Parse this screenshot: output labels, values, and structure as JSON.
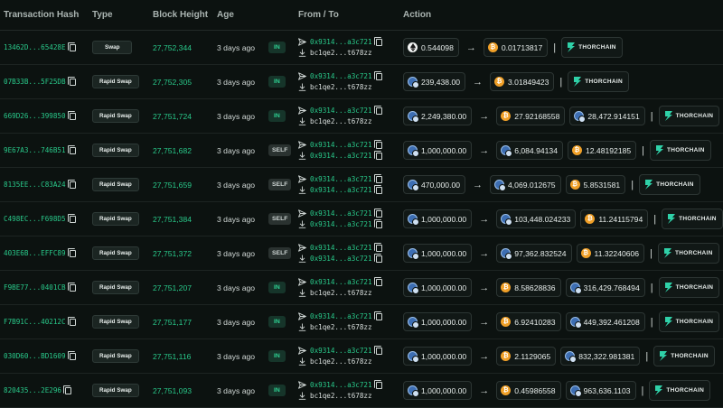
{
  "headers": {
    "hash": "Transaction Hash",
    "type": "Type",
    "block": "Block Height",
    "age": "Age",
    "from_to": "From / To",
    "action": "Action"
  },
  "colors": {
    "accent_green": "#29c98a",
    "btc_orange": "#f0a028",
    "background": "#0c1210"
  },
  "rows": [
    {
      "hash": "13462D...65428E",
      "type": "Swap",
      "block": "27,752,344",
      "age": "3 days ago",
      "dir": "IN",
      "from": "0x9314...a3c721",
      "to": "bc1qe2...t678zz",
      "action": [
        {
          "kind": "amount",
          "coin": "eth-icon",
          "text": "0.544098"
        },
        {
          "kind": "arrow",
          "text": "→"
        },
        {
          "kind": "amount",
          "coin": "btc-icon",
          "text": "0.01713817"
        },
        {
          "kind": "sep",
          "text": "|"
        },
        {
          "kind": "thorchain",
          "text": "THORCHAIN"
        }
      ]
    },
    {
      "hash": "07B33B...5F25DB",
      "type": "Rapid Swap",
      "block": "27,752,305",
      "age": "3 days ago",
      "dir": "IN",
      "from": "0x9314...a3c721",
      "to": "bc1qe2...t678zz",
      "action": [
        {
          "kind": "amount",
          "coin": "token-icon",
          "text": "239,438.00"
        },
        {
          "kind": "arrow",
          "text": "→"
        },
        {
          "kind": "amount",
          "coin": "btc-icon",
          "text": "3.01849423"
        },
        {
          "kind": "sep",
          "text": "|"
        },
        {
          "kind": "thorchain",
          "text": "THORCHAIN"
        }
      ]
    },
    {
      "hash": "669D26...399850",
      "type": "Rapid Swap",
      "block": "27,751,724",
      "age": "3 days ago",
      "dir": "IN",
      "from": "0x9314...a3c721",
      "to": "bc1qe2...t678zz",
      "action": [
        {
          "kind": "amount",
          "coin": "token-icon",
          "text": "2,249,380.00"
        },
        {
          "kind": "arrow",
          "text": "→"
        },
        {
          "kind": "amount",
          "coin": "btc-icon",
          "text": "27.92168558"
        },
        {
          "kind": "amount",
          "coin": "token-icon",
          "text": "28,472.914151"
        },
        {
          "kind": "sep",
          "text": "|"
        },
        {
          "kind": "thorchain",
          "text": "THORCHAIN"
        }
      ]
    },
    {
      "hash": "9E67A3...746B51",
      "type": "Rapid Swap",
      "block": "27,751,682",
      "age": "3 days ago",
      "dir": "SELF",
      "from": "0x9314...a3c721",
      "to": "0x9314...a3c721",
      "action": [
        {
          "kind": "amount",
          "coin": "token-icon",
          "text": "1,000,000.00"
        },
        {
          "kind": "arrow",
          "text": "→"
        },
        {
          "kind": "amount",
          "coin": "token-icon",
          "text": "6,084.94134"
        },
        {
          "kind": "amount",
          "coin": "btc-icon",
          "text": "12.48192185"
        },
        {
          "kind": "sep",
          "text": "|"
        },
        {
          "kind": "thorchain",
          "text": "THORCHAIN"
        }
      ]
    },
    {
      "hash": "8135EE...C83A24",
      "type": "Rapid Swap",
      "block": "27,751,659",
      "age": "3 days ago",
      "dir": "SELF",
      "from": "0x9314...a3c721",
      "to": "0x9314...a3c721",
      "action": [
        {
          "kind": "amount",
          "coin": "token-icon",
          "text": "470,000.00"
        },
        {
          "kind": "arrow",
          "text": "→"
        },
        {
          "kind": "amount",
          "coin": "token-icon",
          "text": "4,069.012675"
        },
        {
          "kind": "amount",
          "coin": "btc-icon",
          "text": "5.8531581"
        },
        {
          "kind": "sep",
          "text": "|"
        },
        {
          "kind": "thorchain",
          "text": "THORCHAIN"
        }
      ]
    },
    {
      "hash": "C498EC...F698D5",
      "type": "Rapid Swap",
      "block": "27,751,384",
      "age": "3 days ago",
      "dir": "SELF",
      "from": "0x9314...a3c721",
      "to": "0x9314...a3c721",
      "action": [
        {
          "kind": "amount",
          "coin": "token-icon",
          "text": "1,000,000.00"
        },
        {
          "kind": "arrow",
          "text": "→"
        },
        {
          "kind": "amount",
          "coin": "token-icon",
          "text": "103,448.024233"
        },
        {
          "kind": "amount",
          "coin": "btc-icon",
          "text": "11.24115794"
        },
        {
          "kind": "sep",
          "text": "|"
        },
        {
          "kind": "thorchain",
          "text": "THORCHAIN"
        }
      ]
    },
    {
      "hash": "403E6B...EFFC89",
      "type": "Rapid Swap",
      "block": "27,751,372",
      "age": "3 days ago",
      "dir": "SELF",
      "from": "0x9314...a3c721",
      "to": "0x9314...a3c721",
      "action": [
        {
          "kind": "amount",
          "coin": "token-icon",
          "text": "1,000,000.00"
        },
        {
          "kind": "arrow",
          "text": "→"
        },
        {
          "kind": "amount",
          "coin": "token-icon",
          "text": "97,362.832524"
        },
        {
          "kind": "amount",
          "coin": "btc-icon",
          "text": "11.32240606"
        },
        {
          "kind": "sep",
          "text": "|"
        },
        {
          "kind": "thorchain",
          "text": "THORCHAIN"
        }
      ]
    },
    {
      "hash": "F9BE77...0401CB",
      "type": "Rapid Swap",
      "block": "27,751,207",
      "age": "3 days ago",
      "dir": "IN",
      "from": "0x9314...a3c721",
      "to": "bc1qe2...t678zz",
      "action": [
        {
          "kind": "amount",
          "coin": "token-icon",
          "text": "1,000,000.00"
        },
        {
          "kind": "arrow",
          "text": "→"
        },
        {
          "kind": "amount",
          "coin": "btc-icon",
          "text": "8.58628836"
        },
        {
          "kind": "amount",
          "coin": "token-icon",
          "text": "316,429.768494"
        },
        {
          "kind": "sep",
          "text": "|"
        },
        {
          "kind": "thorchain",
          "text": "THORCHAIN"
        }
      ]
    },
    {
      "hash": "F7B91C...40212C",
      "type": "Rapid Swap",
      "block": "27,751,177",
      "age": "3 days ago",
      "dir": "IN",
      "from": "0x9314...a3c721",
      "to": "bc1qe2...t678zz",
      "action": [
        {
          "kind": "amount",
          "coin": "token-icon",
          "text": "1,000,000.00"
        },
        {
          "kind": "arrow",
          "text": "→"
        },
        {
          "kind": "amount",
          "coin": "btc-icon",
          "text": "6.92410283"
        },
        {
          "kind": "amount",
          "coin": "token-icon",
          "text": "449,392.461208"
        },
        {
          "kind": "sep",
          "text": "|"
        },
        {
          "kind": "thorchain",
          "text": "THORCHAIN"
        }
      ]
    },
    {
      "hash": "030D60...BD1609",
      "type": "Rapid Swap",
      "block": "27,751,116",
      "age": "3 days ago",
      "dir": "IN",
      "from": "0x9314...a3c721",
      "to": "bc1qe2...t678zz",
      "action": [
        {
          "kind": "amount",
          "coin": "token-icon",
          "text": "1,000,000.00"
        },
        {
          "kind": "arrow",
          "text": "→"
        },
        {
          "kind": "amount",
          "coin": "btc-icon",
          "text": "2.1129065"
        },
        {
          "kind": "amount",
          "coin": "token-icon",
          "text": "832,322.981381"
        },
        {
          "kind": "sep",
          "text": "|"
        },
        {
          "kind": "thorchain",
          "text": "THORCHAIN"
        }
      ]
    },
    {
      "hash": "820435...2E296",
      "type": "Rapid Swap",
      "block": "27,751,093",
      "age": "3 days ago",
      "dir": "IN",
      "from": "0x9314...a3c721",
      "to": "bc1qe2...t678zz",
      "action": [
        {
          "kind": "amount",
          "coin": "token-icon",
          "text": "1,000,000.00"
        },
        {
          "kind": "arrow",
          "text": "→"
        },
        {
          "kind": "amount",
          "coin": "btc-icon",
          "text": "0.45986558"
        },
        {
          "kind": "amount",
          "coin": "token-icon",
          "text": "963,636.1103"
        },
        {
          "kind": "sep",
          "text": "|"
        },
        {
          "kind": "thorchain",
          "text": "THORCHAIN"
        }
      ]
    }
  ]
}
